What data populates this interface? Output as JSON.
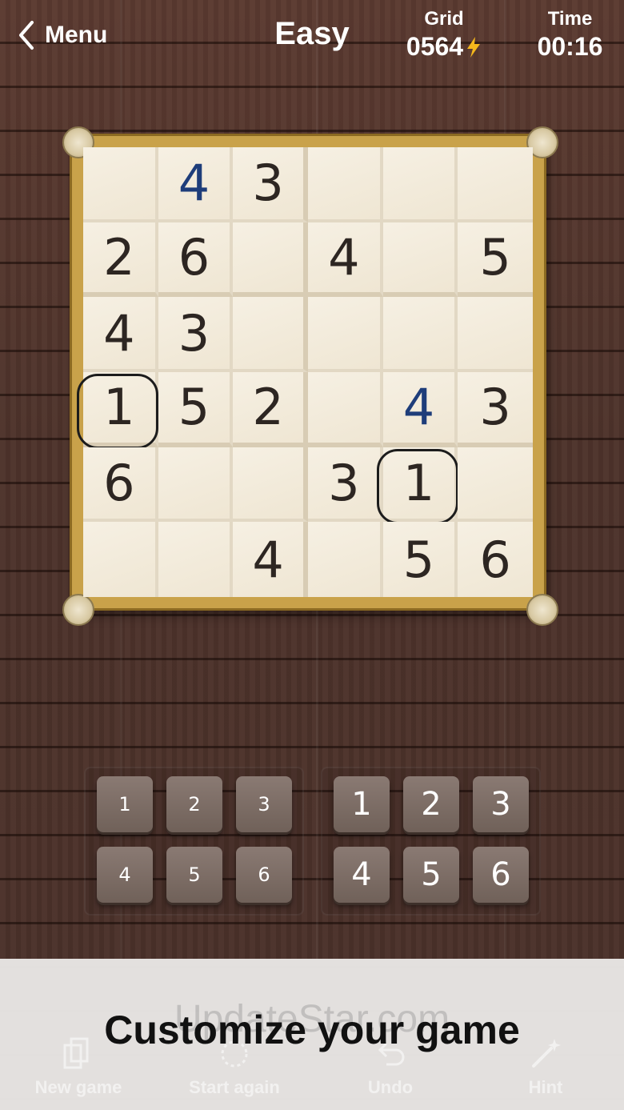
{
  "header": {
    "menu_label": "Menu",
    "difficulty": "Easy",
    "grid_label": "Grid",
    "grid_value": "0564",
    "time_label": "Time",
    "time_value": "00:16"
  },
  "board": {
    "rows": [
      [
        "",
        "4",
        "3",
        "",
        "",
        ""
      ],
      [
        "2",
        "6",
        "",
        "4",
        "",
        "5"
      ],
      [
        "4",
        "3",
        "",
        "",
        "",
        ""
      ],
      [
        "1",
        "5",
        "2",
        "",
        "4",
        "3"
      ],
      [
        "6",
        "",
        "",
        "3",
        "1",
        ""
      ],
      [
        "",
        "",
        "4",
        "",
        "5",
        "6"
      ]
    ],
    "user_entered": [
      [
        0,
        1
      ],
      [
        3,
        4
      ]
    ],
    "circled": [
      [
        3,
        0
      ],
      [
        4,
        4
      ]
    ],
    "colors": {
      "given": "#2d2622",
      "user": "#1e3d7a"
    }
  },
  "keypad_left": [
    "1",
    "2",
    "3",
    "4",
    "5",
    "6"
  ],
  "keypad_right": [
    "1",
    "2",
    "3",
    "4",
    "5",
    "6"
  ],
  "toolbar": {
    "new_game": "New game",
    "start_again": "Start again",
    "undo": "Undo",
    "hint": "Hint"
  },
  "watermark": "UpdateStar.com",
  "banner": "Customize your game"
}
